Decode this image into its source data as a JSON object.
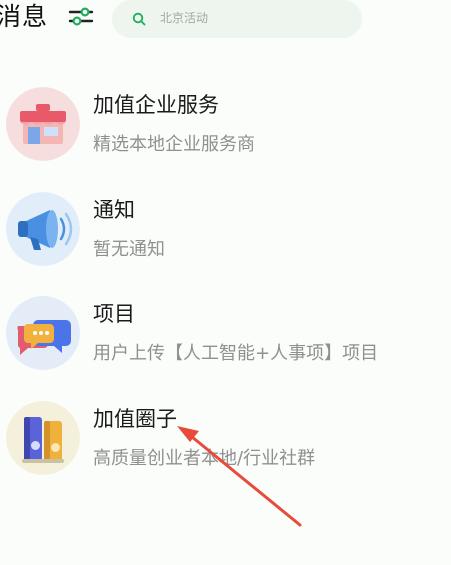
{
  "header": {
    "title": "消息",
    "filter_icon": "sliders-icon",
    "search": {
      "placeholder": "北京活动",
      "icon": "search-icon"
    }
  },
  "messages": [
    {
      "title": "加值企业服务",
      "subtitle": "精选本地企业服务商",
      "icon": "storefront-icon"
    },
    {
      "title": "通知",
      "subtitle": "暂无通知",
      "icon": "megaphone-icon"
    },
    {
      "title": "项目",
      "subtitle": "用户上传【人工智能+人事项】项目",
      "icon": "chat-bubbles-icon"
    },
    {
      "title": "加值圈子",
      "subtitle": "高质量创业者本地/行业社群",
      "icon": "binders-icon"
    }
  ],
  "annotation": {
    "color": "#e84a3c",
    "icon": "red-arrow"
  },
  "colors": {
    "accent": "#1fae5a",
    "background": "#fbfdfb",
    "search_bg": "#eef4ee"
  }
}
